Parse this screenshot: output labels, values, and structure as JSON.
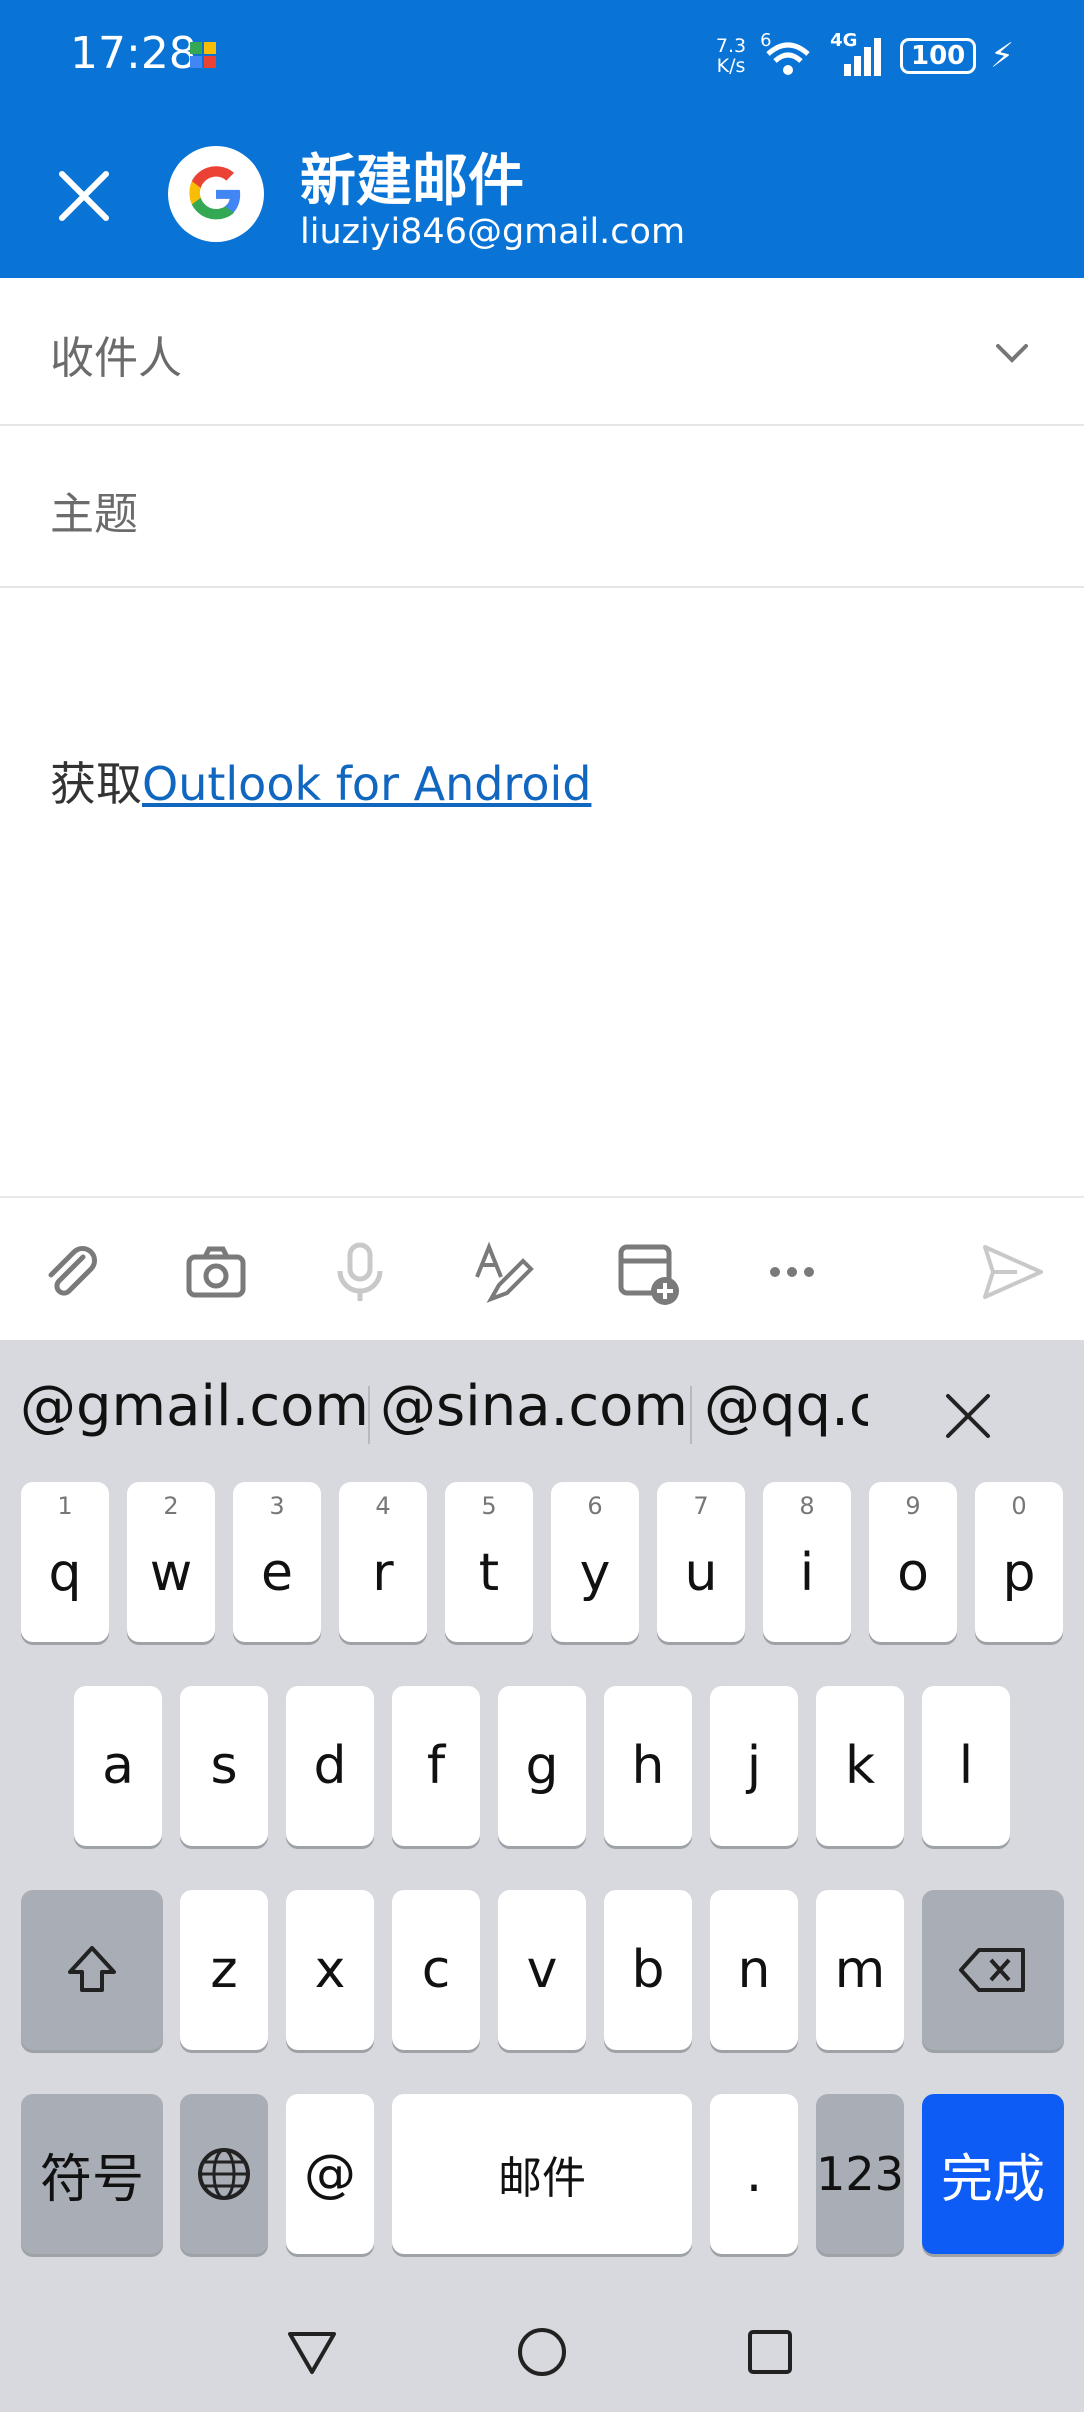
{
  "status_bar": {
    "time": "17:28",
    "net_speed_value": "7.3",
    "net_speed_unit": "K/s",
    "wifi_label": "6",
    "cell_label": "4G",
    "battery": "100"
  },
  "header": {
    "title": "新建邮件",
    "account": "liuziyi846@gmail.com"
  },
  "fields": {
    "to_label": "收件人",
    "subject_label": "主题"
  },
  "body": {
    "prefix": "获取",
    "link_text": "Outlook for Android"
  },
  "toolbar": {
    "icons": [
      "paperclip-icon",
      "camera-icon",
      "microphone-icon",
      "text-format-icon",
      "calendar-add-icon",
      "more-icon",
      "send-icon"
    ]
  },
  "keyboard": {
    "suggestions": [
      "@gmail.com",
      "@sina.com",
      "@qq.c"
    ],
    "row1": [
      {
        "k": "q",
        "n": "1"
      },
      {
        "k": "w",
        "n": "2"
      },
      {
        "k": "e",
        "n": "3"
      },
      {
        "k": "r",
        "n": "4"
      },
      {
        "k": "t",
        "n": "5"
      },
      {
        "k": "y",
        "n": "6"
      },
      {
        "k": "u",
        "n": "7"
      },
      {
        "k": "i",
        "n": "8"
      },
      {
        "k": "o",
        "n": "9"
      },
      {
        "k": "p",
        "n": "0"
      }
    ],
    "row2": [
      "a",
      "s",
      "d",
      "f",
      "g",
      "h",
      "j",
      "k",
      "l"
    ],
    "row3": [
      "z",
      "x",
      "c",
      "v",
      "b",
      "n",
      "m"
    ],
    "symbols": "符号",
    "at": "@",
    "space": "邮件",
    "period": ".",
    "numbers": "123",
    "done": "完成"
  },
  "colors": {
    "header": "#0a74d6",
    "link": "#1167c0",
    "done_key": "#0d5cf6",
    "keyboard_bg": "#d7d9de"
  }
}
